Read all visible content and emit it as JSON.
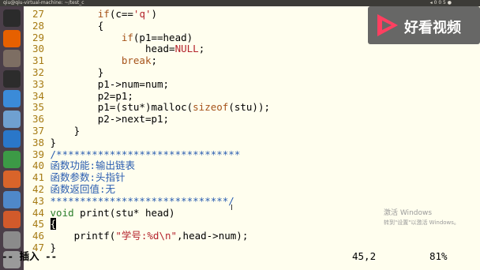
{
  "topbar": {
    "window_title": "qiu@qiu-virtual-machine: ~/test_c",
    "status_right": "◂ 0 0 5 ●"
  },
  "launcher": {
    "items": [
      {
        "name": "dash-icon",
        "color": "#2b2b2b"
      },
      {
        "name": "firefox-icon",
        "color": "#e66000"
      },
      {
        "name": "files-icon",
        "color": "#7d6e63"
      },
      {
        "name": "terminal-icon",
        "color": "#2c2c2c"
      },
      {
        "name": "chromium-icon",
        "color": "#3b8bd8"
      },
      {
        "name": "settings-icon",
        "color": "#6fa0d0"
      },
      {
        "name": "writer-icon",
        "color": "#2a77c9"
      },
      {
        "name": "calc-icon",
        "color": "#3c9a46"
      },
      {
        "name": "impress-icon",
        "color": "#d9642a"
      },
      {
        "name": "software-center-icon",
        "color": "#4f88c9"
      },
      {
        "name": "amazon-icon",
        "color": "#d15a2b"
      },
      {
        "name": "system-settings-icon",
        "color": "#8b8b8b"
      },
      {
        "name": "trash-icon",
        "color": "#9a9a9a"
      }
    ]
  },
  "watermark": {
    "text": "好看视频"
  },
  "windows_activation": {
    "line1": "激活 Windows",
    "line2": "转到\"设置\"以激活 Windows。"
  },
  "editor": {
    "lines": [
      {
        "n": "27",
        "parts": [
          {
            "t": "        ",
            "c": "code"
          },
          {
            "t": "if",
            "c": "kw"
          },
          {
            "t": "(c==",
            "c": "code"
          },
          {
            "t": "'q'",
            "c": "str"
          },
          {
            "t": ")",
            "c": "code"
          }
        ]
      },
      {
        "n": "28",
        "parts": [
          {
            "t": "        {",
            "c": "code"
          }
        ]
      },
      {
        "n": "29",
        "parts": [
          {
            "t": "            ",
            "c": "code"
          },
          {
            "t": "if",
            "c": "kw"
          },
          {
            "t": "(p1==head)",
            "c": "code"
          }
        ]
      },
      {
        "n": "30",
        "parts": [
          {
            "t": "                head=",
            "c": "code"
          },
          {
            "t": "NULL",
            "c": "const"
          },
          {
            "t": ";",
            "c": "code"
          }
        ]
      },
      {
        "n": "31",
        "parts": [
          {
            "t": "            ",
            "c": "code"
          },
          {
            "t": "break",
            "c": "kw"
          },
          {
            "t": ";",
            "c": "code"
          }
        ]
      },
      {
        "n": "32",
        "parts": [
          {
            "t": "        }",
            "c": "code"
          }
        ]
      },
      {
        "n": "33",
        "parts": [
          {
            "t": "        p1->num=num;",
            "c": "code"
          }
        ]
      },
      {
        "n": "34",
        "parts": [
          {
            "t": "        p2=p1;",
            "c": "code"
          }
        ]
      },
      {
        "n": "35",
        "parts": [
          {
            "t": "        p1=(stu*)malloc(",
            "c": "code"
          },
          {
            "t": "sizeof",
            "c": "kw"
          },
          {
            "t": "(stu));",
            "c": "code"
          }
        ]
      },
      {
        "n": "36",
        "parts": [
          {
            "t": "        p2->next=p1;",
            "c": "code"
          }
        ]
      },
      {
        "n": "37",
        "parts": [
          {
            "t": "    }",
            "c": "code"
          }
        ]
      },
      {
        "n": "38",
        "parts": [
          {
            "t": "}",
            "c": "code"
          }
        ]
      },
      {
        "n": "39",
        "parts": [
          {
            "t": "/*******************************",
            "c": "cm"
          }
        ]
      },
      {
        "n": "40",
        "parts": [
          {
            "t": "函数功能:输出链表",
            "c": "cm"
          }
        ]
      },
      {
        "n": "41",
        "parts": [
          {
            "t": "函数参数:头指针",
            "c": "cm"
          }
        ]
      },
      {
        "n": "42",
        "parts": [
          {
            "t": "函数返回值:无",
            "c": "cm"
          }
        ]
      },
      {
        "n": "43",
        "parts": [
          {
            "t": "******************************/",
            "c": "cm"
          }
        ]
      },
      {
        "n": "44",
        "parts": [
          {
            "t": "void",
            "c": "ty"
          },
          {
            "t": " print(stu* head)",
            "c": "code"
          }
        ]
      },
      {
        "n": "45",
        "parts": [
          {
            "t": "{",
            "c": "cursor"
          }
        ]
      },
      {
        "n": "46",
        "parts": [
          {
            "t": "    printf(",
            "c": "code"
          },
          {
            "t": "\"学号:",
            "c": "str"
          },
          {
            "t": "%d\\n",
            "c": "fmt"
          },
          {
            "t": "\"",
            "c": "str"
          },
          {
            "t": ",head->num);",
            "c": "code"
          }
        ]
      },
      {
        "n": "47",
        "parts": [
          {
            "t": "}",
            "c": "code"
          }
        ]
      }
    ]
  },
  "statusline": {
    "mode": "-- 插入 --",
    "position": "45,2",
    "percent": "81%"
  }
}
